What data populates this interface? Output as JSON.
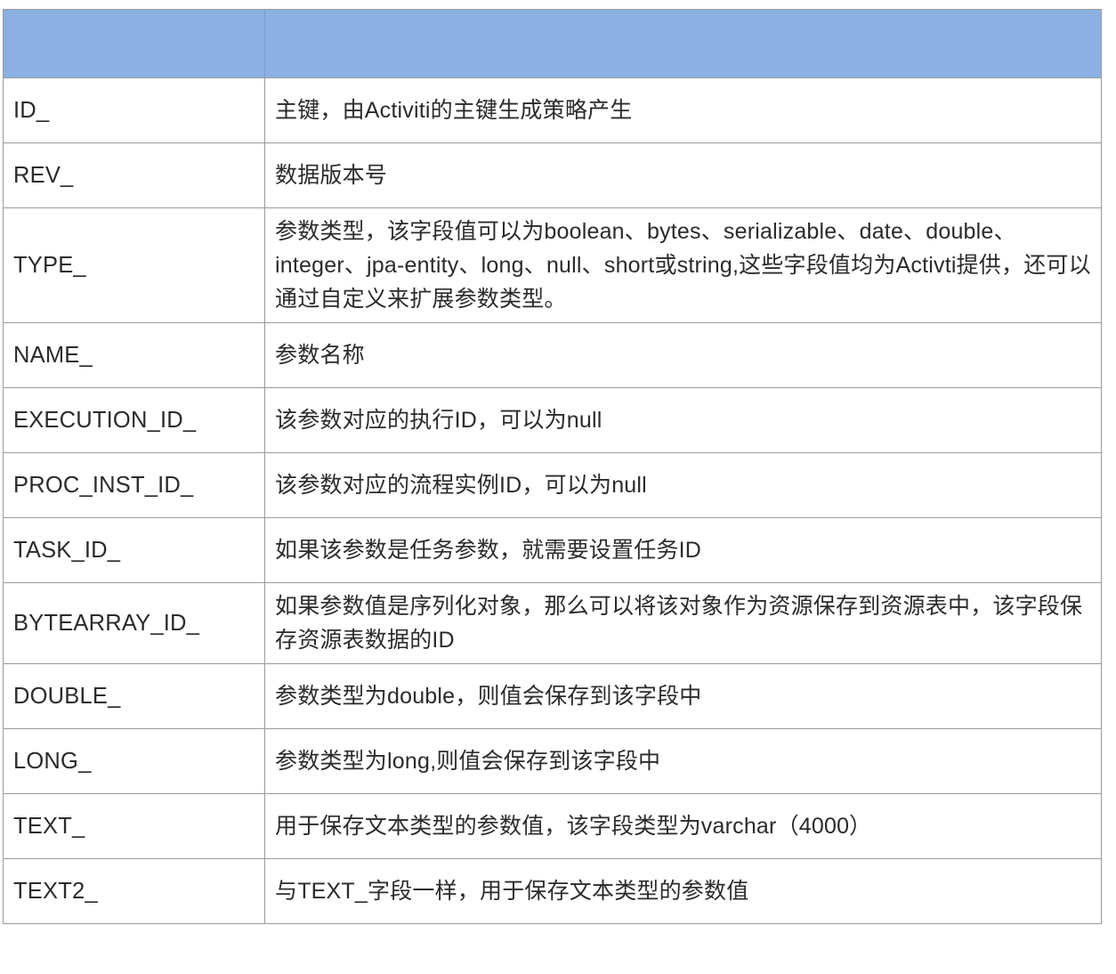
{
  "table": {
    "header": {
      "field_label": "",
      "description_label": ""
    },
    "header_fill": "#8CB0E3",
    "border_color": "#9a9a9a",
    "rows": [
      {
        "field": "ID_",
        "description": "主键，由Activiti的主键生成策略产生"
      },
      {
        "field": "REV_",
        "description": "数据版本号"
      },
      {
        "field": "TYPE_",
        "description": "参数类型，该字段值可以为boolean、bytes、serializable、date、double、integer、jpa-entity、long、null、short或string,这些字段值均为Activti提供，还可以通过自定义来扩展参数类型。"
      },
      {
        "field": "NAME_",
        "description": "参数名称"
      },
      {
        "field": "EXECUTION_ID_",
        "description": "该参数对应的执行ID，可以为null"
      },
      {
        "field": "PROC_INST_ID_",
        "description": "该参数对应的流程实例ID，可以为null"
      },
      {
        "field": "TASK_ID_",
        "description": "如果该参数是任务参数，就需要设置任务ID"
      },
      {
        "field": "BYTEARRAY_ID_",
        "description": "如果参数值是序列化对象，那么可以将该对象作为资源保存到资源表中，该字段保存资源表数据的ID"
      },
      {
        "field": "DOUBLE_",
        "description": "参数类型为double，则值会保存到该字段中"
      },
      {
        "field": "LONG_",
        "description": "参数类型为long,则值会保存到该字段中"
      },
      {
        "field": "TEXT_",
        "description": "用于保存文本类型的参数值，该字段类型为varchar（4000）"
      },
      {
        "field": "TEXT2_",
        "description": "与TEXT_字段一样，用于保存文本类型的参数值"
      }
    ]
  }
}
